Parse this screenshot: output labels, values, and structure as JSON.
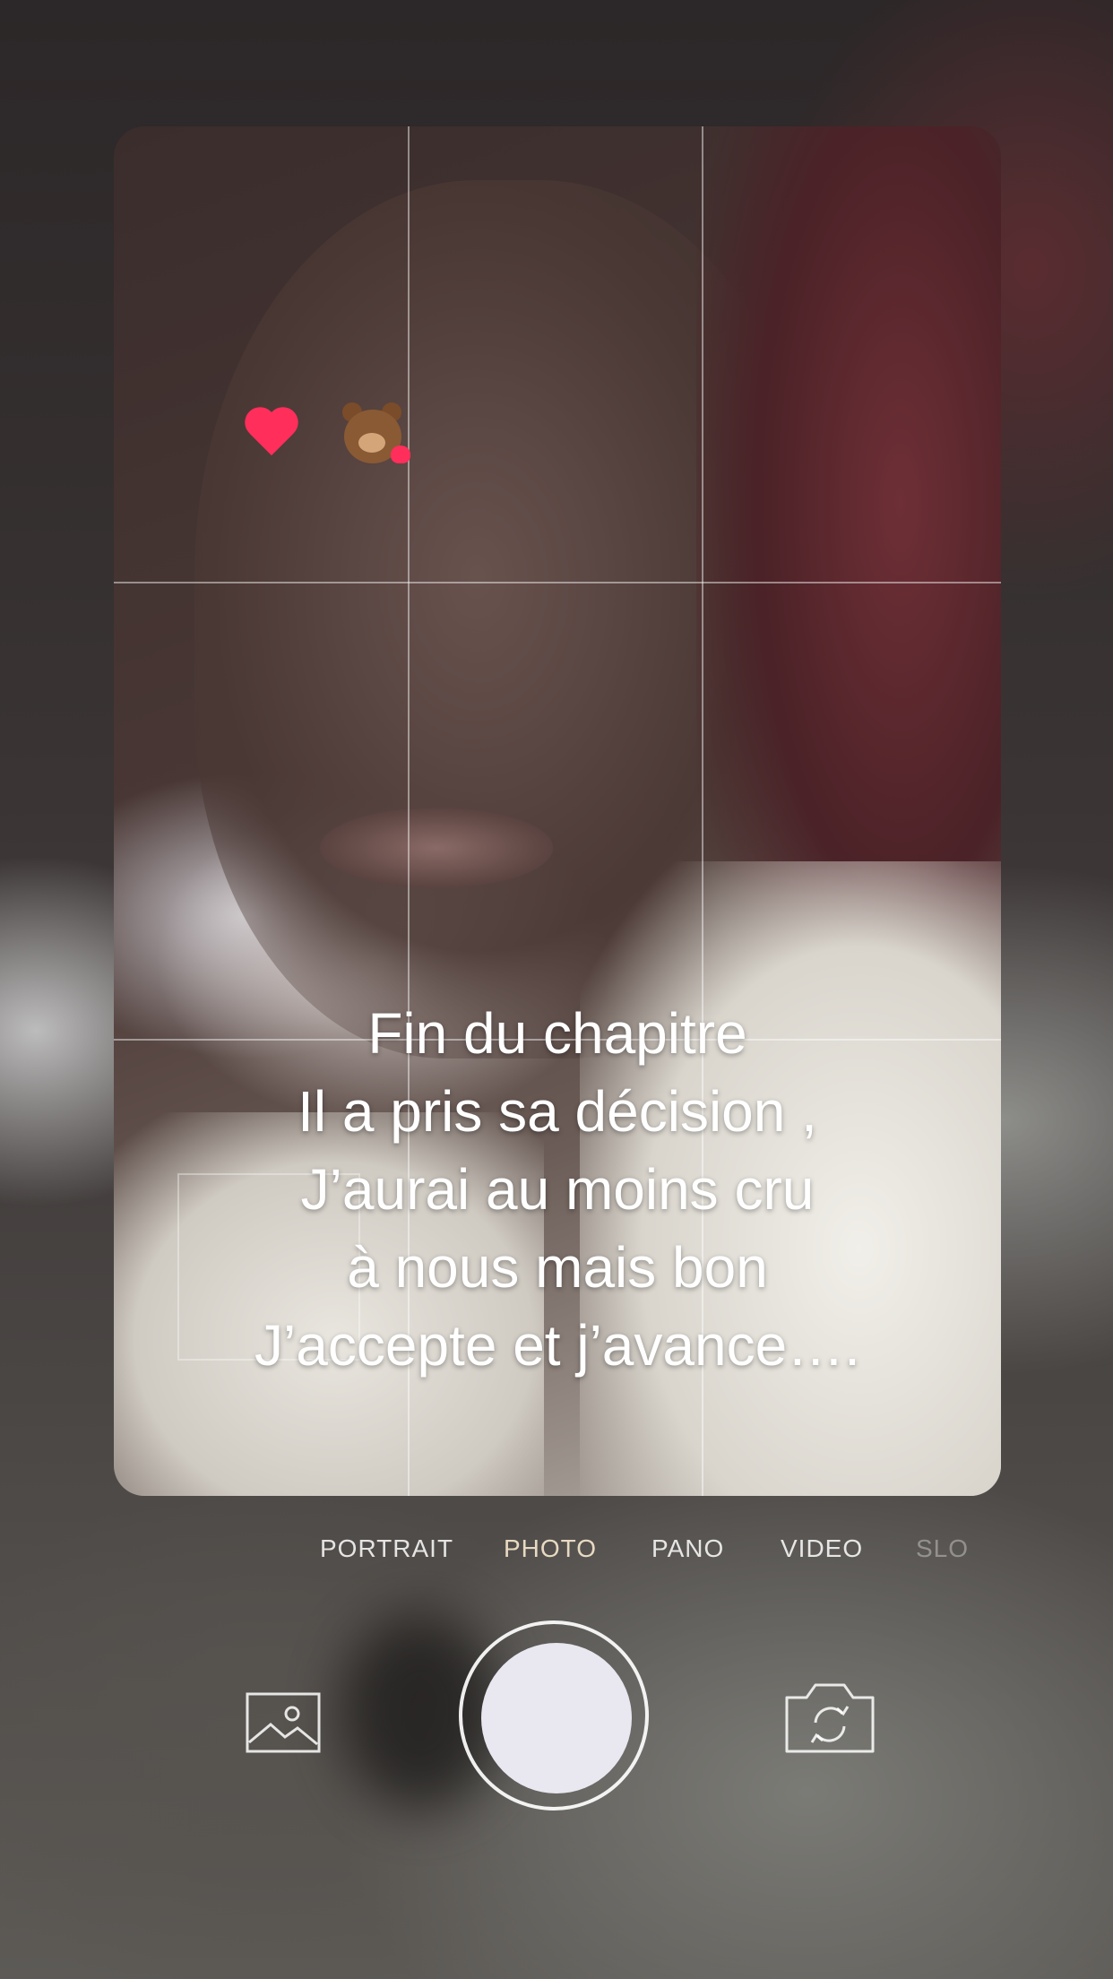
{
  "caption": {
    "lines": [
      "Fin du chapitre",
      "Il a pris sa décision ,",
      "J’aurai au moins cru",
      "à nous mais bon",
      "J’accepte et j’avance…."
    ]
  },
  "camera": {
    "modes": [
      "PORTRAIT",
      "PHOTO",
      "PANO",
      "VIDEO",
      "SLO"
    ],
    "active_mode": "PHOTO"
  },
  "icons": {
    "gallery": "gallery-icon",
    "switch_camera": "switch-camera-icon",
    "stickers": [
      "heart-icon",
      "bear-icon"
    ]
  },
  "colors": {
    "active_mode": "#e8d9c2",
    "shutter": "#e9e8f0",
    "heart": "#ff2e5a"
  }
}
